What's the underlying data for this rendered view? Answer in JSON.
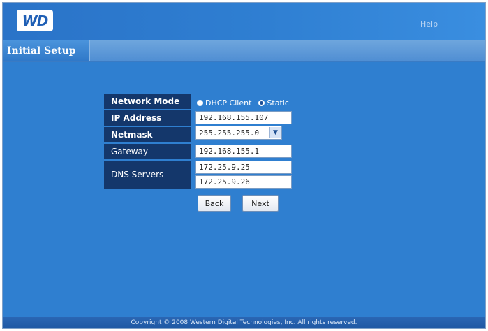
{
  "header": {
    "logo_text": "WD",
    "help_label": "Help"
  },
  "tab": {
    "label": "Initial Setup"
  },
  "form": {
    "network_mode": {
      "label": "Network Mode",
      "options": [
        "DHCP Client",
        "Static"
      ],
      "selected": "Static"
    },
    "ip_address": {
      "label": "IP Address",
      "value": "192.168.155.107"
    },
    "netmask": {
      "label": "Netmask",
      "value": "255.255.255.0"
    },
    "gateway": {
      "label": "Gateway",
      "value": "192.168.155.1"
    },
    "dns_servers": {
      "label": "DNS Servers",
      "values": [
        "172.25.9.25",
        "172.25.9.26"
      ]
    }
  },
  "buttons": {
    "back": "Back",
    "next": "Next"
  },
  "footer": {
    "copyright": "Copyright © 2008 Western Digital Technologies, Inc. All rights reserved."
  },
  "colors": {
    "background": "#2f7fd0",
    "label_cell": "#14376b",
    "footer": "#1f58a4"
  }
}
